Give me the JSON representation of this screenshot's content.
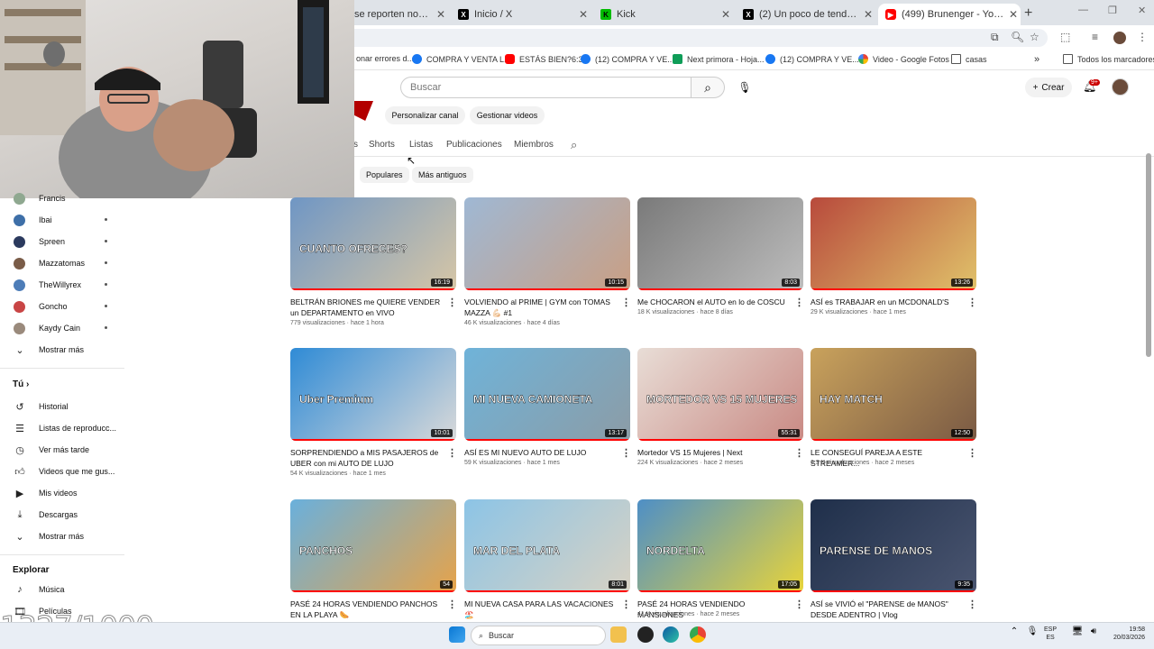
{
  "browser": {
    "tabs": [
      {
        "label": "se reporten no? #regga",
        "favicon": "tab-icon"
      },
      {
        "label": "Inicio / X",
        "favicon": "x-logo-icon"
      },
      {
        "label": "Kick",
        "favicon": "kick-logo-icon"
      },
      {
        "label": "(2) Un poco de tendencias en X",
        "favicon": "x-logo-icon"
      },
      {
        "label": "(499) Brunenger - YouTube",
        "favicon": "youtube-logo-icon",
        "active": true
      }
    ],
    "bookmarks": [
      {
        "label": "onar errores d...",
        "color": "#ffffff"
      },
      {
        "label": "COMPRA Y VENTA L...",
        "color": "#1877f2"
      },
      {
        "label": "ESTÁS BIEN?6:33",
        "color": "#ff0000"
      },
      {
        "label": "(12) COMPRA Y VE...",
        "color": "#1877f2"
      },
      {
        "label": "Next primora - Hoja...",
        "color": "#0f9d58"
      },
      {
        "label": "(12) COMPRA Y VE...",
        "color": "#1877f2"
      },
      {
        "label": "Video - Google Fotos",
        "color": "#fbbc04"
      },
      {
        "label": "casas",
        "color": "#888888"
      }
    ],
    "bookmarks_more": "»",
    "all_bookmarks": "Todos los marcadores"
  },
  "header": {
    "search_placeholder": "Buscar",
    "create_label": "Crear",
    "notif_count": "9+"
  },
  "channel": {
    "customize_label": "Personalizar canal",
    "manage_label": "Gestionar videos",
    "tabs": [
      "s",
      "Shorts",
      "Listas",
      "Publicaciones",
      "Miembros"
    ],
    "chips": [
      "Populares",
      "Más antiguos"
    ]
  },
  "sidebar": {
    "subscriptions": [
      {
        "name": "Francis",
        "color": "#8fa890"
      },
      {
        "name": "Ibai",
        "color": "#3e6fa8"
      },
      {
        "name": "Spreen",
        "color": "#2b3a5e"
      },
      {
        "name": "Mazzatomas",
        "color": "#7a5c48"
      },
      {
        "name": "TheWillyrex",
        "color": "#4d7db8"
      },
      {
        "name": "Goncho",
        "color": "#c94545"
      },
      {
        "name": "Kaydy Cain",
        "color": "#9a8a7c"
      }
    ],
    "show_more": "Mostrar más",
    "you_section": "Tú",
    "you_items": [
      {
        "label": "Historial",
        "icon": "history-icon"
      },
      {
        "label": "Listas de reproducc...",
        "icon": "playlists-icon"
      },
      {
        "label": "Ver más tarde",
        "icon": "watch-later-icon"
      },
      {
        "label": "Videos que me gus...",
        "icon": "liked-icon"
      },
      {
        "label": "Mis videos",
        "icon": "my-videos-icon"
      },
      {
        "label": "Descargas",
        "icon": "downloads-icon"
      },
      {
        "label": "Mostrar más",
        "icon": "chevron-down-icon"
      }
    ],
    "explore_section": "Explorar",
    "explore_items": [
      {
        "label": "Música",
        "icon": "music-icon"
      },
      {
        "label": "Películas",
        "icon": "movies-icon"
      }
    ]
  },
  "videos": [
    {
      "title": "BELTRÁN BRIONES me QUIERE VENDER un DEPARTAMENTO en VIVO",
      "views": "779 visualizaciones",
      "age": "hace 1 hora",
      "duration": "16:19",
      "colors": [
        "#6f96c4",
        "#d6c6a6"
      ],
      "overlay": "CUANTO OFRECES?"
    },
    {
      "title": "VOLVIENDO al PRIME | GYM con TOMAS MAZZA 💪🏻 #1",
      "views": "46 K visualizaciones",
      "age": "hace 4 días",
      "duration": "10:15",
      "colors": [
        "#9fb8d4",
        "#c99f84"
      ],
      "overlay": ""
    },
    {
      "title": "Me CHOCARON el AUTO en lo de COSCU",
      "views": "18 K visualizaciones",
      "age": "hace 8 días",
      "duration": "8:03",
      "colors": [
        "#7a7a7a",
        "#bdbdbd"
      ],
      "overlay": ""
    },
    {
      "title": "ASÍ es TRABAJAR en un MCDONALD'S",
      "views": "29 K visualizaciones",
      "age": "hace 1 mes",
      "duration": "13:26",
      "colors": [
        "#b84a3c",
        "#e0c26a"
      ],
      "overlay": ""
    },
    {
      "title": "SORPRENDIENDO a MIS PASAJEROS de UBER con mi AUTO DE LUJO",
      "views": "54 K visualizaciones",
      "age": "hace 1 mes",
      "duration": "10:01",
      "colors": [
        "#2f8bd6",
        "#d9d9d9"
      ],
      "overlay": "Uber Premium"
    },
    {
      "title": "ASÍ ES MI NUEVO AUTO DE LUJO",
      "views": "59 K visualizaciones",
      "age": "hace 1 mes",
      "duration": "13:17",
      "colors": [
        "#6fb3d9",
        "#8c9ca6"
      ],
      "overlay": "MI NUEVA CAMIONETA"
    },
    {
      "title": "Mortedor VS 15 Mujeres | Next",
      "views": "224 K visualizaciones",
      "age": "hace 2 meses",
      "duration": "55:31",
      "colors": [
        "#e8ddd6",
        "#c98a84"
      ],
      "overlay": "MORTEDOR VS 15 MUJERES"
    },
    {
      "title": "LE CONSEGUÍ PAREJA A ESTE STREAMER...",
      "views": "6,3 K visualizaciones",
      "age": "hace 2 meses",
      "duration": "12:50",
      "colors": [
        "#c9a25c",
        "#7a5a44"
      ],
      "overlay": "HAY MATCH"
    },
    {
      "title": "PASÉ 24 HORAS VENDIENDO PANCHOS EN LA PLAYA 🌭",
      "views": "",
      "age": "",
      "duration": "54",
      "colors": [
        "#6ab0dc",
        "#e6a34a"
      ],
      "overlay": "PANCHOS"
    },
    {
      "title": "MI NUEVA CASA PARA LAS VACACIONES 🏖️",
      "views": "",
      "age": "",
      "duration": "8:01",
      "colors": [
        "#8cc4e6",
        "#d8d2c4"
      ],
      "overlay": "MAR DEL PLATA"
    },
    {
      "title": "PASÉ 24 HORAS VENDIENDO MANSIONES",
      "views": "41 K visualizaciones",
      "age": "hace 2 meses",
      "duration": "17:05",
      "colors": [
        "#4e8fc6",
        "#e8d43a"
      ],
      "overlay": "NORDELTA"
    },
    {
      "title": "ASÍ se VIVIÓ el \"PARENSE de MANOS\" DESDE ADENTRO | Vlog",
      "views": "",
      "age": "",
      "duration": "9:35",
      "colors": [
        "#1f2f4a",
        "#4a5570"
      ],
      "overlay": "PARENSE DE MANOS"
    }
  ],
  "stream_overlay": {
    "counter": "1327/1000"
  },
  "taskbar": {
    "search_label": "Buscar",
    "lang_top": "ESP",
    "lang_bottom": "ES",
    "time": "19:58",
    "date": "20/03/2026"
  }
}
